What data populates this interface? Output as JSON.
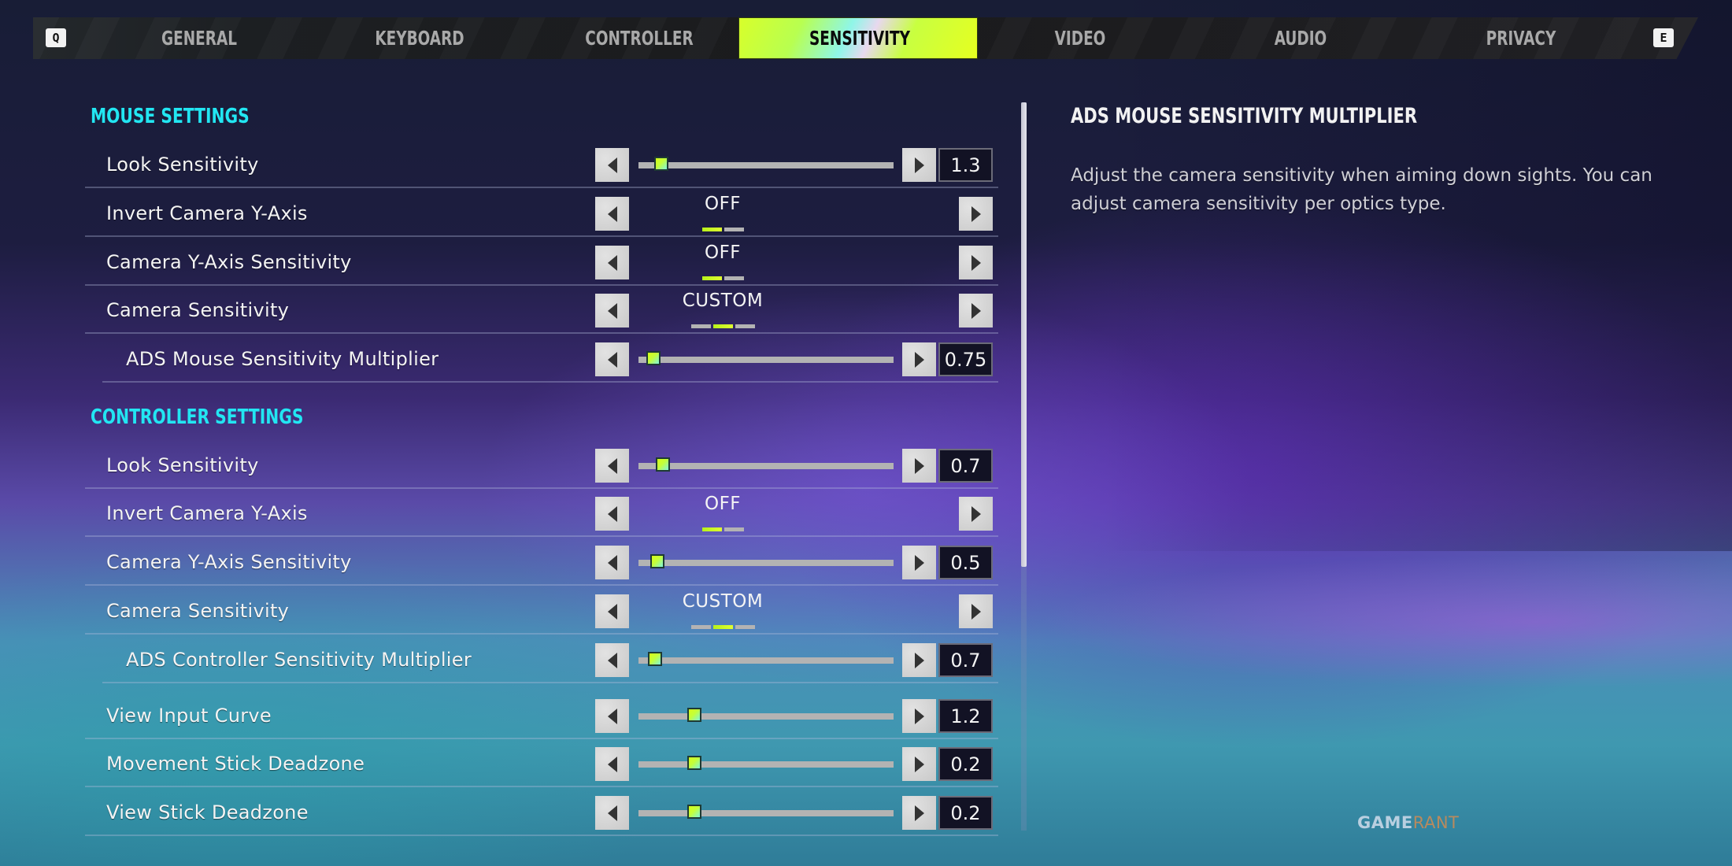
{
  "tabs": {
    "prev_key": "Q",
    "next_key": "E",
    "items": [
      {
        "label": "GENERAL",
        "selected": false
      },
      {
        "label": "KEYBOARD",
        "selected": false
      },
      {
        "label": "CONTROLLER",
        "selected": false
      },
      {
        "label": "SENSITIVITY",
        "selected": true
      },
      {
        "label": "VIDEO",
        "selected": false
      },
      {
        "label": "AUDIO",
        "selected": false
      },
      {
        "label": "PRIVACY",
        "selected": false
      }
    ]
  },
  "sections": [
    {
      "heading": "MOUSE SETTINGS",
      "rows": [
        {
          "label": "Look Sensitivity",
          "type": "slider",
          "value": "1.3",
          "fill_fraction": 0.09,
          "sub": false
        },
        {
          "label": "Invert Camera Y-Axis",
          "type": "select",
          "value": "OFF",
          "options_count": 2,
          "selected_index": 0,
          "sub": false
        },
        {
          "label": "Camera Y-Axis Sensitivity",
          "type": "select",
          "value": "OFF",
          "options_count": 2,
          "selected_index": 0,
          "sub": false
        },
        {
          "label": "Camera Sensitivity",
          "type": "select",
          "value": "CUSTOM",
          "options_count": 3,
          "selected_index": 1,
          "sub": false
        },
        {
          "label": "ADS Mouse Sensitivity Multiplier",
          "type": "slider",
          "value": "0.75",
          "fill_fraction": 0.06,
          "sub": true
        }
      ]
    },
    {
      "heading": "CONTROLLER SETTINGS",
      "rows": [
        {
          "label": "Look Sensitivity",
          "type": "slider",
          "value": "0.7",
          "fill_fraction": 0.095,
          "sub": false
        },
        {
          "label": "Invert Camera Y-Axis",
          "type": "select",
          "value": "OFF",
          "options_count": 2,
          "selected_index": 0,
          "sub": false
        },
        {
          "label": "Camera Y-Axis Sensitivity",
          "type": "select_slider",
          "value": "0.5",
          "fill_fraction": 0.075,
          "sub": false
        },
        {
          "label": "Camera Sensitivity",
          "type": "select",
          "value": "CUSTOM",
          "options_count": 3,
          "selected_index": 1,
          "sub": false
        },
        {
          "label": "ADS Controller Sensitivity Multiplier",
          "type": "slider",
          "value": "0.7",
          "fill_fraction": 0.065,
          "sub": true
        },
        {
          "label": "View Input Curve",
          "type": "slider",
          "value": "1.2",
          "fill_fraction": 0.22,
          "sub": false
        },
        {
          "label": "Movement Stick Deadzone",
          "type": "slider",
          "value": "0.2",
          "fill_fraction": 0.22,
          "sub": false
        },
        {
          "label": "View Stick Deadzone",
          "type": "slider",
          "value": "0.2",
          "fill_fraction": 0.22,
          "sub": false
        }
      ]
    }
  ],
  "info_panel": {
    "title": "ADS MOUSE SENSITIVITY MULTIPLIER",
    "description": "Adjust the camera sensitivity when aiming down sights. You can adjust camera sensitivity per optics type."
  },
  "watermark": {
    "part1": "GAME",
    "part2": "RANT"
  },
  "colors": {
    "accent_heading": "#22e6f2",
    "accent_selected": "#d6ff1a",
    "value_box_bg": "#121224"
  }
}
